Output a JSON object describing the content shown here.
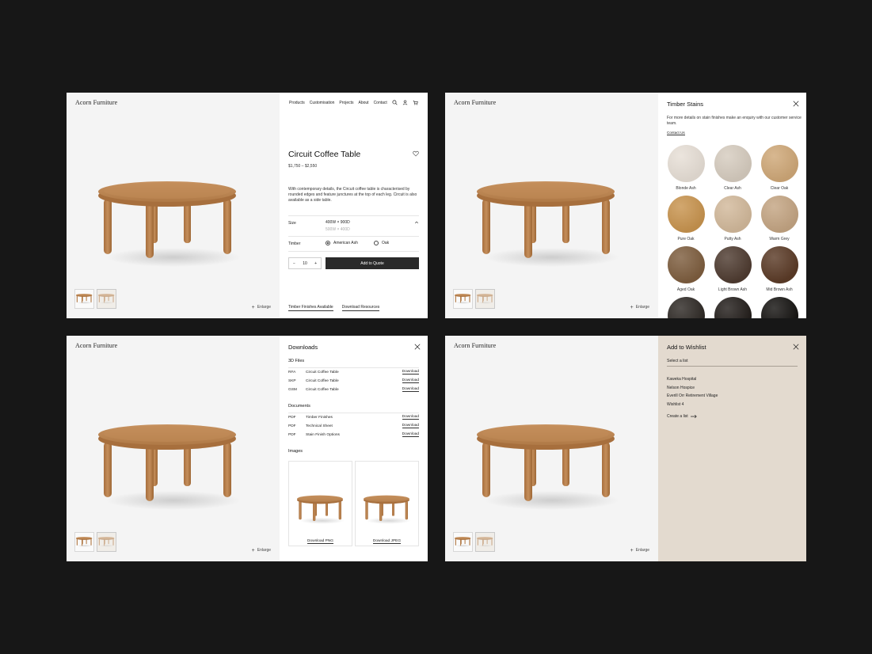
{
  "brand": "Acorn Furniture",
  "nav": [
    "Products",
    "Customisation",
    "Projects",
    "About",
    "Contact"
  ],
  "enlarge": "Enlarge",
  "product": {
    "title": "Circuit Coffee Table",
    "price": "$1,750 – $2,550",
    "description": "With contemporary details, the Circuit coffee table is characterised by rounded edges and feature junctures at the top of each leg. Circuit is also available as a side table.",
    "size_label": "Size",
    "size_options": [
      "400W × 900D",
      "500W × 400D"
    ],
    "timber_label": "Timber",
    "timber_options": [
      {
        "label": "American Ash",
        "selected": true
      },
      {
        "label": "Oak",
        "selected": false
      }
    ],
    "quantity": "10",
    "qty_minus": "−",
    "qty_plus": "+",
    "add_button": "Add to Quote",
    "link_finishes": "Timber Finishes Available",
    "link_downloads": "Download Resources"
  },
  "stains": {
    "title": "Timber Stains",
    "description": "For more details on stain finishes make an enquiry with our customer service team.",
    "contact": "Contact Us",
    "swatches": [
      {
        "name": "Blonde Ash",
        "color": "#e7dfd6"
      },
      {
        "name": "Clear Ash",
        "color": "#d6ccbf"
      },
      {
        "name": "Clear Oak",
        "color": "#cfa878"
      },
      {
        "name": "Pure Oak",
        "color": "#c8944f"
      },
      {
        "name": "Putty Ash",
        "color": "#d2b99b"
      },
      {
        "name": "Warm Grey",
        "color": "#c4a583"
      },
      {
        "name": "Aged Oak",
        "color": "#7e5e3f"
      },
      {
        "name": "Light Brown Ash",
        "color": "#4f3c31"
      },
      {
        "name": "Mid Brown Ash",
        "color": "#5b3b27"
      },
      {
        "name": "",
        "color": "#2f2a26"
      },
      {
        "name": "",
        "color": "#231e1b"
      },
      {
        "name": "",
        "color": "#161412"
      }
    ]
  },
  "downloads": {
    "title": "Downloads",
    "files_heading": "3D Files",
    "files": [
      {
        "type": "RFA",
        "name": "Circuit Coffee Table",
        "action": "Download"
      },
      {
        "type": "SKP",
        "name": "Circuit Coffee Table",
        "action": "Download"
      },
      {
        "type": "GSM",
        "name": "Circuit Coffee Table",
        "action": "Download"
      }
    ],
    "docs_heading": "Documents",
    "docs": [
      {
        "type": "PDF",
        "name": "Timber Finishes",
        "action": "Download"
      },
      {
        "type": "PDF",
        "name": "Technical Sheet",
        "action": "Download"
      },
      {
        "type": "PDF",
        "name": "Stain Finish Options",
        "action": "Download"
      }
    ],
    "images_heading": "Images",
    "images": [
      {
        "label": "Download PNG"
      },
      {
        "label": "Download JPEG"
      }
    ]
  },
  "wishlist": {
    "title": "Add to Wishlist",
    "subtitle": "Select a list",
    "lists": [
      "Kaweka Hospital",
      "Nelson Hospice",
      "Everill Orr Retirement Village",
      "Wishlist 4"
    ],
    "create": "Create a list"
  },
  "colors": {
    "background": "#171717",
    "panel_beige": "#e3dacf",
    "button_dark": "#2a2a2a",
    "wood": "#b9844f"
  }
}
